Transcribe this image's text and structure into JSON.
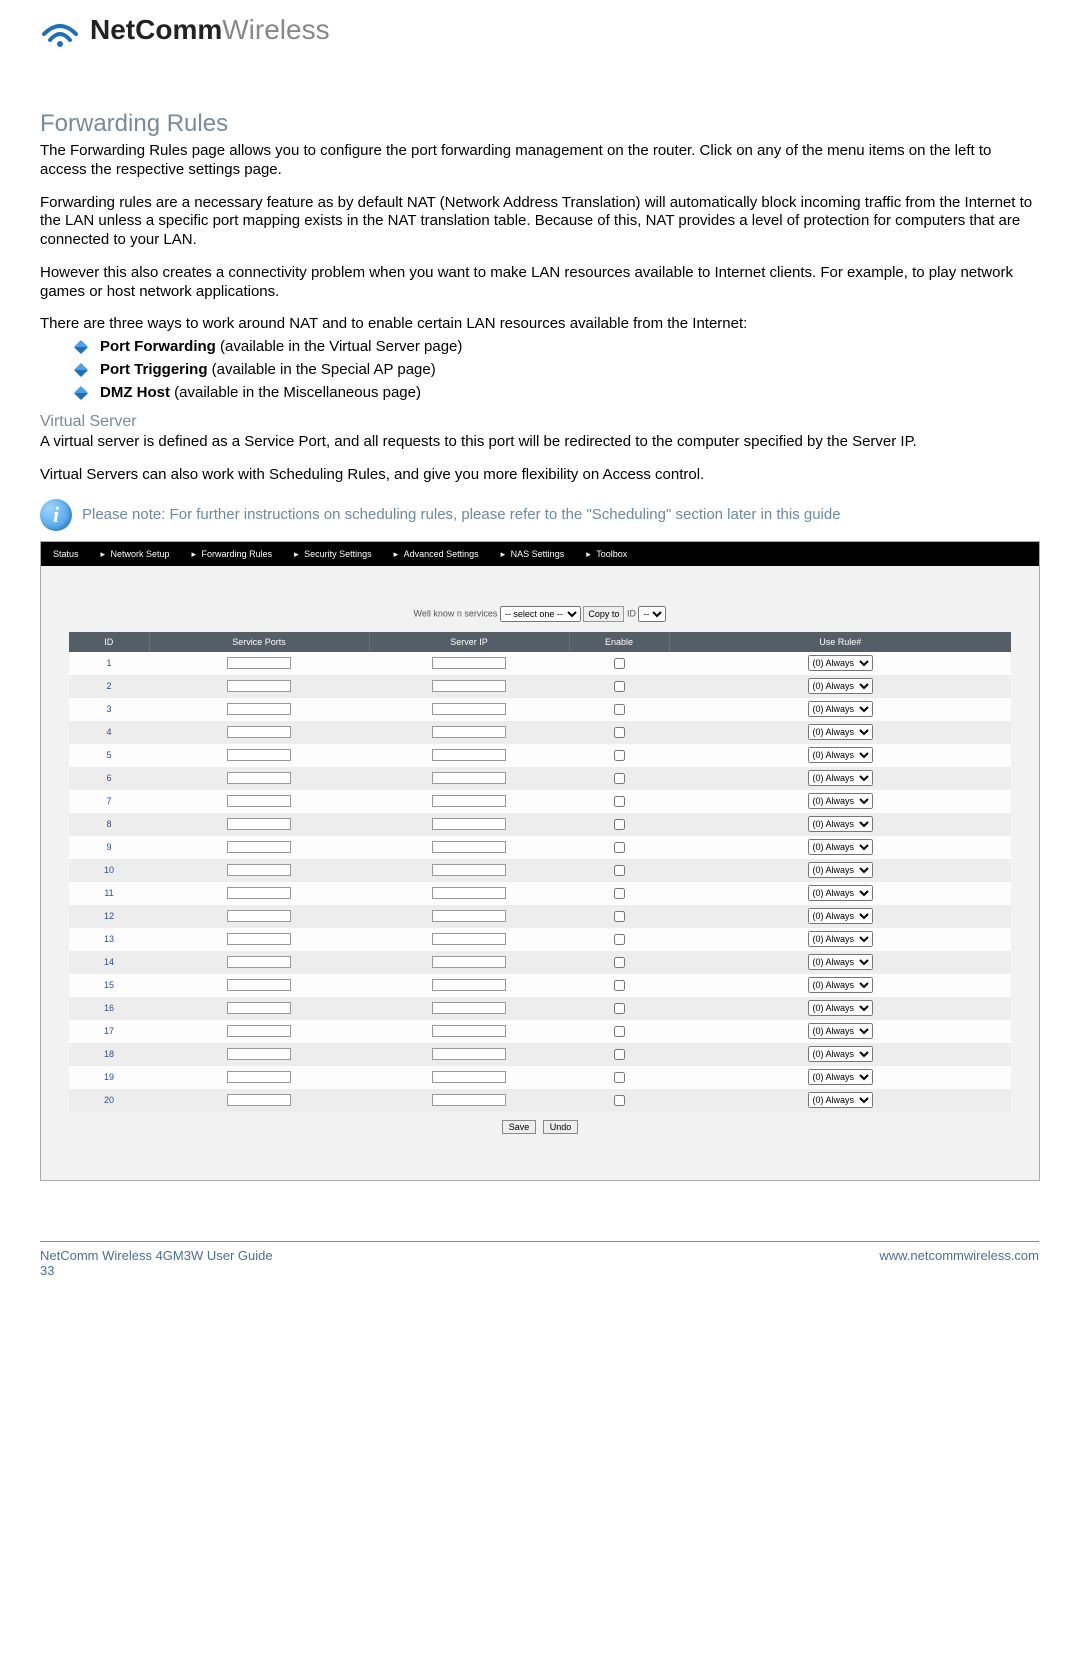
{
  "logo": {
    "brand_bold": "NetComm",
    "brand_light": "Wireless"
  },
  "h1": "Forwarding Rules",
  "p1": "The Forwarding Rules page allows you to configure the port forwarding management on the router. Click on any of the menu items on the left to access the respective settings page.",
  "p2": "Forwarding rules are a necessary feature as by default NAT (Network Address Translation) will automatically block incoming traffic from the Internet to the LAN unless a specific port mapping exists in the NAT translation table. Because of this, NAT provides a level of protection for computers that are connected to your LAN.",
  "p3": "However this also creates a connectivity problem when you want to make LAN resources available to Internet clients. For example, to play network games or host network applications.",
  "p4": "There are three ways to work around NAT and to enable certain LAN resources available from the Internet:",
  "bullets": [
    {
      "bold": "Port Forwarding",
      "rest": " (available in the Virtual Server page)"
    },
    {
      "bold": "Port Triggering",
      "rest": " (available in the Special AP page)"
    },
    {
      "bold": "DMZ Host",
      "rest": " (available in the Miscellaneous page)"
    }
  ],
  "h2": "Virtual Server",
  "p5": "A virtual server is defined as a Service Port, and all requests to this port will be redirected to the computer specified by the Server IP.",
  "p6": "Virtual Servers can also work with Scheduling Rules, and give you more flexibility on Access control.",
  "note": "Please note: For further instructions on scheduling rules, please refer to the \"Scheduling\" section later in this guide",
  "router": {
    "nav": [
      "Status",
      "Network Setup",
      "Forwarding Rules",
      "Security Settings",
      "Advanced Settings",
      "NAS Settings",
      "Toolbox"
    ],
    "toolbar": {
      "label": "Well know n services",
      "select_placeholder": "-- select one --",
      "copy_btn": "Copy to",
      "id_label": "ID",
      "id_select": "--"
    },
    "headers": [
      "ID",
      "Service Ports",
      "Server IP",
      "Enable",
      "Use Rule#"
    ],
    "rows": [
      {
        "id": "1",
        "rule": "(0) Always"
      },
      {
        "id": "2",
        "rule": "(0) Always"
      },
      {
        "id": "3",
        "rule": "(0) Always"
      },
      {
        "id": "4",
        "rule": "(0) Always"
      },
      {
        "id": "5",
        "rule": "(0) Always"
      },
      {
        "id": "6",
        "rule": "(0) Always"
      },
      {
        "id": "7",
        "rule": "(0) Always"
      },
      {
        "id": "8",
        "rule": "(0) Always"
      },
      {
        "id": "9",
        "rule": "(0) Always"
      },
      {
        "id": "10",
        "rule": "(0) Always"
      },
      {
        "id": "11",
        "rule": "(0) Always"
      },
      {
        "id": "12",
        "rule": "(0) Always"
      },
      {
        "id": "13",
        "rule": "(0) Always"
      },
      {
        "id": "14",
        "rule": "(0) Always"
      },
      {
        "id": "15",
        "rule": "(0) Always"
      },
      {
        "id": "16",
        "rule": "(0) Always"
      },
      {
        "id": "17",
        "rule": "(0) Always"
      },
      {
        "id": "18",
        "rule": "(0) Always"
      },
      {
        "id": "19",
        "rule": "(0) Always"
      },
      {
        "id": "20",
        "rule": "(0) Always"
      }
    ],
    "buttons": {
      "save": "Save",
      "undo": "Undo"
    }
  },
  "footer": {
    "left": "NetComm Wireless 4GM3W User Guide",
    "page": "33",
    "right": "www.netcommwireless.com"
  }
}
